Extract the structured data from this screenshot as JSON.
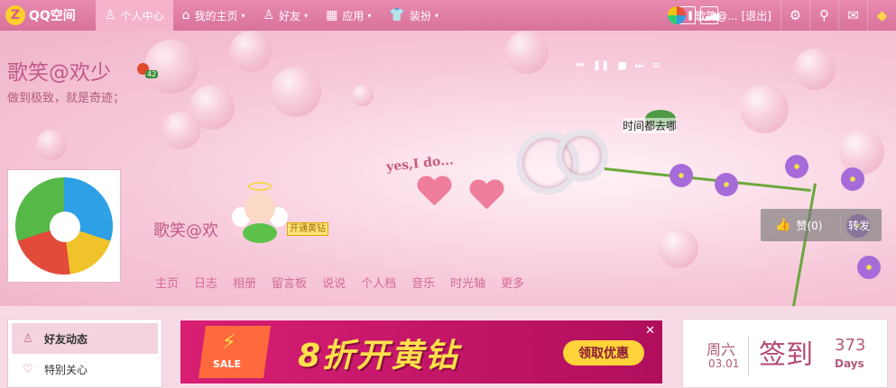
{
  "app": {
    "logo_mark": "Z",
    "logo_text": "QQ空间"
  },
  "topnav": {
    "items": [
      {
        "label": "个人中心",
        "icon": "person-icon",
        "active": true
      },
      {
        "label": "我的主页",
        "icon": "home-icon",
        "has_caret": true
      },
      {
        "label": "好友",
        "icon": "friends-icon",
        "has_caret": true
      },
      {
        "label": "应用",
        "icon": "apps-grid-icon",
        "has_caret": true
      },
      {
        "label": "装扮",
        "icon": "shirt-icon",
        "has_caret": true
      }
    ],
    "caret": "▾",
    "icon_pause": "❚❚",
    "icon_stats": "▁▃▅",
    "user_short": "歌笑@...",
    "logout_label": "[退出]",
    "gear_icon": "⚙",
    "search_icon": "⚲",
    "mail_icon": "✉",
    "diamond_icon": "◆"
  },
  "banner": {
    "profile_name": "歌笑@欢少",
    "level_num": "42",
    "signature": "做到极致，就是奇迹；",
    "yes_text": "yes,I do...",
    "tag_text": "时间都去哪",
    "music": [
      "⏮",
      "❚❚",
      "■",
      "⏭",
      "≡"
    ],
    "owner_name": "歌笑@欢",
    "vip_link": "开通黄钻",
    "profile_nav": [
      "主页",
      "日志",
      "相册",
      "留言板",
      "说说",
      "个人档",
      "音乐",
      "时光轴",
      "更多"
    ],
    "like_label": "赞(0)",
    "like_icon": "👍",
    "share_label": "转发"
  },
  "sidebar": {
    "items": [
      {
        "label": "好友动态",
        "icon": "friends-feed-icon",
        "glyph": "♙",
        "active": true
      },
      {
        "label": "特别关心",
        "icon": "heart-icon",
        "glyph": "♡"
      }
    ]
  },
  "ad": {
    "sale_label": "SALE",
    "bolt": "⚡",
    "title": "8折开黄钻",
    "button_label": "领取优惠",
    "close_label": "✕"
  },
  "checkin": {
    "weekday": "周六",
    "date": "03.01",
    "sign_label": "签到",
    "count": "373",
    "unit": "Days"
  },
  "colors": {
    "topbar": "#d8729b",
    "accent": "#c0588a",
    "ad_bg": "#d81f74",
    "ad_gold": "#ffe14a"
  }
}
